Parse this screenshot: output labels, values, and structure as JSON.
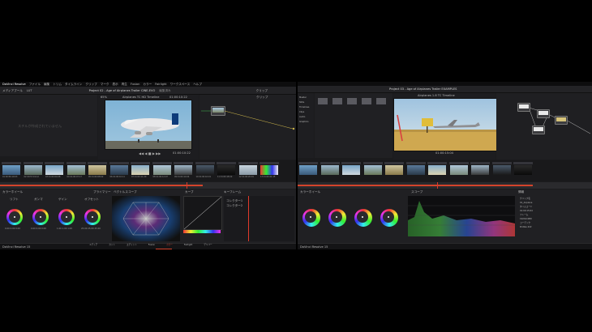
{
  "left": {
    "menu": [
      "DaVinci Resolve",
      "ファイル",
      "編集",
      "トリム",
      "タイムライン",
      "クリップ",
      "マーク",
      "表示",
      "再生",
      "Fusion",
      "カラー",
      "Fairlight",
      "ワークスペース",
      "ヘルプ"
    ],
    "project_title": "Project 02 - Age of Airplanes Trailer CINE-EVO",
    "edited_label": "編集済み",
    "toolbar": [
      "メディアプール",
      "LUT",
      "クリップ"
    ],
    "viewer_timecode": "01:00:10:22",
    "viewer_timeline": "Airplanes  TC HD Timeline",
    "viewer_percent": "65%",
    "viewer_zoom": "63%",
    "clips_label": "クリップ",
    "empty_message": "スチルが作成されていません",
    "playhead_tc": "01:00:10:22",
    "clip_labels": [
      "01",
      "02",
      "03",
      "04",
      "05",
      "06",
      "07",
      "08",
      "09",
      "10",
      "11",
      "12",
      "13"
    ],
    "clip_tcs": [
      "00:56:19:03",
      "00:57:19:12",
      "01:00:04:08",
      "01:00:07:17",
      "01:00:08:02",
      "01:00:10:11",
      "01:00:11:20",
      "01:00:12:07",
      "01:00:14:04",
      "01:00:16:19",
      "01:00:18:22",
      "01:00:20:01",
      "01:00:21:15"
    ],
    "wheels_header": "カラーホイール",
    "mode_label": "プライマリー",
    "wheel_names": [
      "リフト",
      "ガンマ",
      "ゲイン",
      "オフセット"
    ],
    "wheel_values": [
      "0.00  0.00  0.00",
      "0.00  0.00  0.00",
      "1.00  1.00  1.00",
      "25.00 25.00 25.00"
    ],
    "scope_label": "ベクトルスコープ",
    "curves_label": "カーブ",
    "keyframes_label": "キーフレーム",
    "keyframes_items": [
      "コレクター1",
      "コレクター2"
    ],
    "app_name": "DaVinci Resolve 15",
    "pages": [
      "メディア",
      "カット",
      "エディット",
      "Fusion",
      "カラー",
      "Fairlight",
      "デリバー"
    ],
    "active_page": "カラー"
  },
  "right": {
    "project_title": "Project 03 - Age of Airplanes Trailer EXAMPLES",
    "viewer_timecode": "01:00:15:04",
    "timeline_label": "Airplanes  1.8 TC Timeline",
    "sidebar_items": [
      "Master",
      "Stills",
      "Timelines",
      "Clips",
      "Audio",
      "Graphics"
    ],
    "wheels_header": "カラーホイール",
    "scope_label": "スコープ",
    "info_label": "情報",
    "info_lines": [
      "クリップ名",
      "01_Airplane",
      "タイムコード",
      "01:00:15:04",
      "フレーム",
      "1920x1080",
      "コーデック",
      "ProRes 422"
    ],
    "app_name": "DaVinci Resolve 15"
  }
}
